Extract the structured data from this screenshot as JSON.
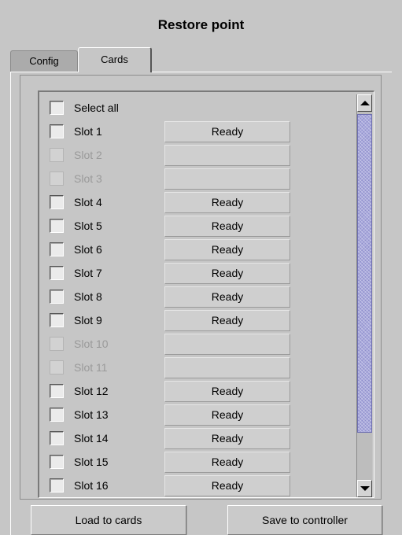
{
  "title": "Restore point",
  "tabs": [
    {
      "label": "Config",
      "active": false
    },
    {
      "label": "Cards",
      "active": true
    }
  ],
  "select_all_label": "Select all",
  "slots": [
    {
      "label": "Slot 1",
      "status": "Ready",
      "enabled": true
    },
    {
      "label": "Slot 2",
      "status": "",
      "enabled": false
    },
    {
      "label": "Slot 3",
      "status": "",
      "enabled": false
    },
    {
      "label": "Slot 4",
      "status": "Ready",
      "enabled": true
    },
    {
      "label": "Slot 5",
      "status": "Ready",
      "enabled": true
    },
    {
      "label": "Slot 6",
      "status": "Ready",
      "enabled": true
    },
    {
      "label": "Slot 7",
      "status": "Ready",
      "enabled": true
    },
    {
      "label": "Slot 8",
      "status": "Ready",
      "enabled": true
    },
    {
      "label": "Slot 9",
      "status": "Ready",
      "enabled": true
    },
    {
      "label": "Slot 10",
      "status": "",
      "enabled": false
    },
    {
      "label": "Slot 11",
      "status": "",
      "enabled": false
    },
    {
      "label": "Slot 12",
      "status": "Ready",
      "enabled": true
    },
    {
      "label": "Slot 13",
      "status": "Ready",
      "enabled": true
    },
    {
      "label": "Slot 14",
      "status": "Ready",
      "enabled": true
    },
    {
      "label": "Slot 15",
      "status": "Ready",
      "enabled": true
    },
    {
      "label": "Slot 16",
      "status": "Ready",
      "enabled": true
    }
  ],
  "buttons": {
    "load": "Load to cards",
    "save": "Save to controller"
  },
  "colors": {
    "background": "#c6c6c6",
    "scroll_thumb": "#a9a9dd",
    "disabled_text": "#9a9a9a"
  }
}
